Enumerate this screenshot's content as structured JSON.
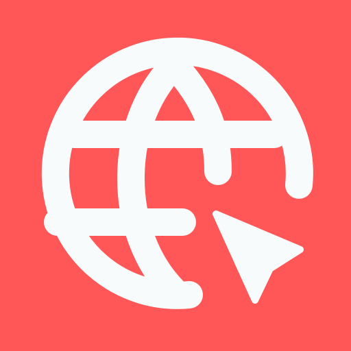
{
  "icon": {
    "name": "globe-with-cursor-icon",
    "colors": {
      "background": "#FF5757",
      "foreground": "#F8FBFC"
    }
  }
}
